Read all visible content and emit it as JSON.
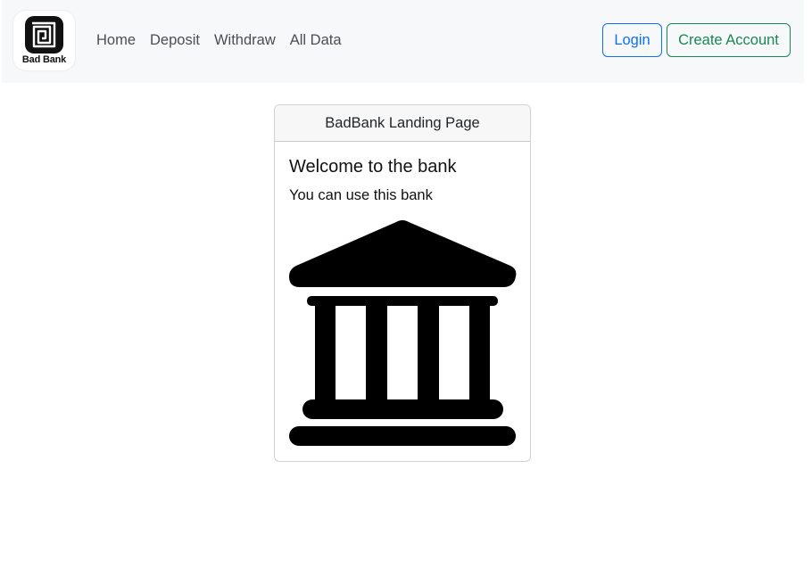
{
  "brand": {
    "logo_icon": "bad-bank-spiral-logo",
    "name": "Bad Bank"
  },
  "nav": {
    "links": [
      "Home",
      "Deposit",
      "Withdraw",
      "All Data"
    ]
  },
  "actions": {
    "login": "Login",
    "create_account": "Create Account"
  },
  "card": {
    "header": "BadBank Landing Page",
    "title": "Welcome to the bank",
    "text": "You can use this bank",
    "image_icon": "bank-building-icon"
  },
  "colors": {
    "navbar_bg": "#f7f8fa",
    "primary": "#0d6efd",
    "success": "#198754"
  }
}
